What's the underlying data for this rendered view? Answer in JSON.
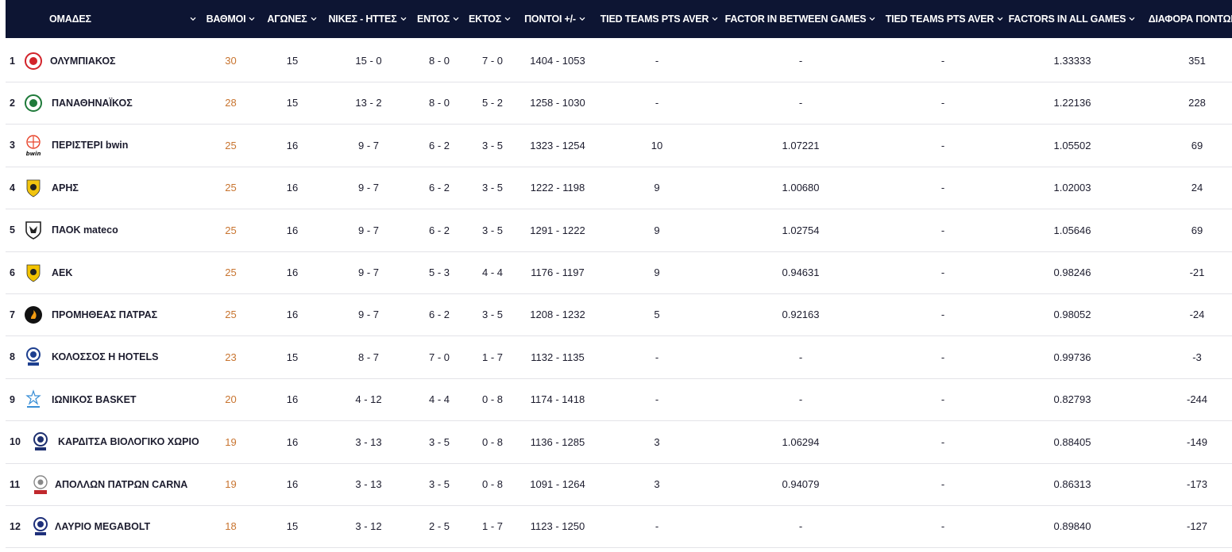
{
  "header": {
    "team": "ΟΜΑΔΕΣ",
    "points": "ΒΑΘΜΟΙ",
    "games": "ΑΓΩΝΕΣ",
    "wl": "ΝΙΚΕΣ - ΗΤΤΕΣ",
    "home": "ΕΝΤΟΣ",
    "away": "ΕΚΤΟΣ",
    "pf": "ΠΟΝΤΟΙ +/-",
    "tied1": "TIED TEAMS PTS AVER",
    "factor_between": "FACTOR IN BETWEEN GAMES",
    "tied2": "TIED TEAMS PTS AVER",
    "factor_all": "FACTORS IN ALL GAMES",
    "diff": "ΔΙΑΦΟΡΑ ΠΟΝΤΩΝ"
  },
  "rows": [
    {
      "rank": "1",
      "team": "ΟΛΥΜΠΙΑΚΟΣ",
      "points": "30",
      "games": "15",
      "wl": "15 - 0",
      "home": "8 - 0",
      "away": "7 - 0",
      "pf": "1404 - 1053",
      "tied1": "-",
      "factor_between": "-",
      "tied2": "-",
      "factor_all": "1.33333",
      "diff": "351",
      "logo": "olympiacos-logo-icon",
      "logo_color": "#d2232a"
    },
    {
      "rank": "2",
      "team": "ΠΑΝΑΘΗΝΑΪΚΟΣ",
      "points": "28",
      "games": "15",
      "wl": "13 - 2",
      "home": "8 - 0",
      "away": "5 - 2",
      "pf": "1258 - 1030",
      "tied1": "-",
      "factor_between": "-",
      "tied2": "-",
      "factor_all": "1.22136",
      "diff": "228",
      "logo": "panathinaikos-logo-icon",
      "logo_color": "#1f7a3a"
    },
    {
      "rank": "3",
      "team": "ΠΕΡΙΣΤΕΡΙ bwin",
      "points": "25",
      "games": "16",
      "wl": "9 - 7",
      "home": "6 - 2",
      "away": "3 - 5",
      "pf": "1323 - 1254",
      "tied1": "10",
      "factor_between": "1.07221",
      "tied2": "-",
      "factor_all": "1.05502",
      "diff": "69",
      "logo": "peristeri-logo-icon",
      "logo_color": "#e8432a"
    },
    {
      "rank": "4",
      "team": "ΑΡΗΣ",
      "points": "25",
      "games": "16",
      "wl": "9 - 7",
      "home": "6 - 2",
      "away": "3 - 5",
      "pf": "1222 - 1198",
      "tied1": "9",
      "factor_between": "1.00680",
      "tied2": "-",
      "factor_all": "1.02003",
      "diff": "24",
      "logo": "aris-logo-icon",
      "logo_color": "#f1c40f"
    },
    {
      "rank": "5",
      "team": "ΠΑΟΚ mateco",
      "points": "25",
      "games": "16",
      "wl": "9 - 7",
      "home": "6 - 2",
      "away": "3 - 5",
      "pf": "1291 - 1222",
      "tied1": "9",
      "factor_between": "1.02754",
      "tied2": "-",
      "factor_all": "1.05646",
      "diff": "69",
      "logo": "paok-logo-icon",
      "logo_color": "#222222"
    },
    {
      "rank": "6",
      "team": "ΑΕΚ",
      "points": "25",
      "games": "16",
      "wl": "9 - 7",
      "home": "5 - 3",
      "away": "4 - 4",
      "pf": "1176 - 1197",
      "tied1": "9",
      "factor_between": "0.94631",
      "tied2": "-",
      "factor_all": "0.98246",
      "diff": "-21",
      "logo": "aek-logo-icon",
      "logo_color": "#f3c300"
    },
    {
      "rank": "7",
      "team": "ΠΡΟΜΗΘΕΑΣ ΠΑΤΡΑΣ",
      "points": "25",
      "games": "16",
      "wl": "9 - 7",
      "home": "6 - 2",
      "away": "3 - 5",
      "pf": "1208 - 1232",
      "tied1": "5",
      "factor_between": "0.92163",
      "tied2": "-",
      "factor_all": "0.98052",
      "diff": "-24",
      "logo": "promitheas-logo-icon",
      "logo_color": "#111111"
    },
    {
      "rank": "8",
      "team": "ΚΟΛΟΣΣΟΣ H HOTELS",
      "points": "23",
      "games": "15",
      "wl": "8 - 7",
      "home": "7 - 0",
      "away": "1 - 7",
      "pf": "1132 - 1135",
      "tied1": "-",
      "factor_between": "-",
      "tied2": "-",
      "factor_all": "0.99736",
      "diff": "-3",
      "logo": "kolossos-logo-icon",
      "logo_color": "#1d3f8f"
    },
    {
      "rank": "9",
      "team": "ΙΩΝΙΚΟΣ BASKET",
      "points": "20",
      "games": "16",
      "wl": "4 - 12",
      "home": "4 - 4",
      "away": "0 - 8",
      "pf": "1174 - 1418",
      "tied1": "-",
      "factor_between": "-",
      "tied2": "-",
      "factor_all": "0.82793",
      "diff": "-244",
      "logo": "ionikos-logo-icon",
      "logo_color": "#3a8fd6"
    },
    {
      "rank": "10",
      "team": "ΚΑΡΔΙΤΣΑ ΒΙΟΛΟΓΙΚΟ ΧΩΡΙΟ",
      "points": "19",
      "games": "16",
      "wl": "3 - 13",
      "home": "3 - 5",
      "away": "0 - 8",
      "pf": "1136 - 1285",
      "tied1": "3",
      "factor_between": "1.06294",
      "tied2": "-",
      "factor_all": "0.88405",
      "diff": "-149",
      "logo": "karditsa-logo-icon",
      "logo_color": "#1d2f6f"
    },
    {
      "rank": "11",
      "team": "ΑΠΟΛΛΩΝ ΠΑΤΡΩΝ CARNA",
      "points": "19",
      "games": "16",
      "wl": "3 - 13",
      "home": "3 - 5",
      "away": "0 - 8",
      "pf": "1091 - 1264",
      "tied1": "3",
      "factor_between": "0.94079",
      "tied2": "-",
      "factor_all": "0.86313",
      "diff": "-173",
      "logo": "apollon-logo-icon",
      "logo_color": "#c0282d"
    },
    {
      "rank": "12",
      "team": "ΛΑΥΡΙΟ MEGABOLT",
      "points": "18",
      "games": "15",
      "wl": "3 - 12",
      "home": "2 - 5",
      "away": "1 - 7",
      "pf": "1123 - 1250",
      "tied1": "-",
      "factor_between": "-",
      "tied2": "-",
      "factor_all": "0.89840",
      "diff": "-127",
      "logo": "lavrio-logo-icon",
      "logo_color": "#1e2f7a"
    }
  ]
}
